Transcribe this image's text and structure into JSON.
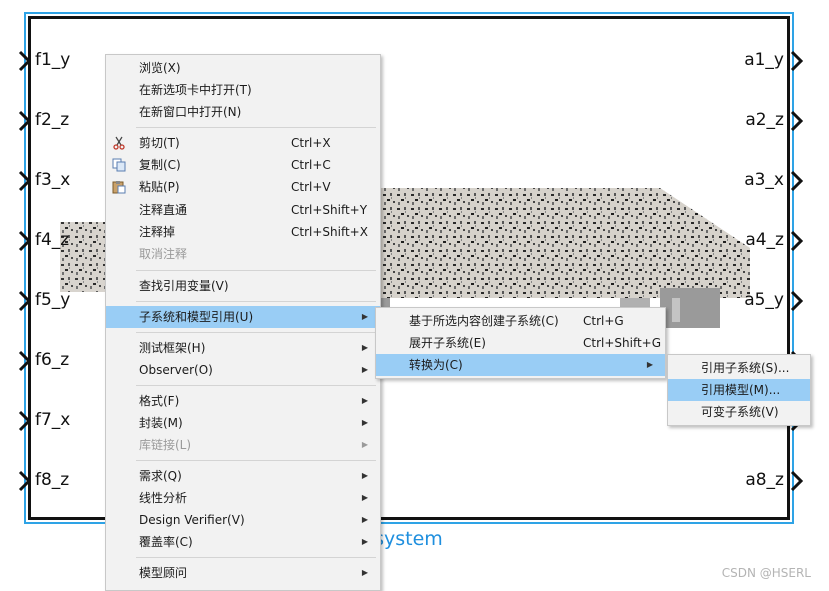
{
  "block": {
    "name_visible": "ubsystem",
    "inputs": [
      "f1_y",
      "f2_z",
      "f3_x",
      "f4_z",
      "f5_y",
      "f6_z",
      "f7_x",
      "f8_z"
    ],
    "outputs": [
      "a1_y",
      "a2_z",
      "a3_x",
      "a4_z",
      "a5_y",
      "a8_z"
    ]
  },
  "menu": {
    "items": [
      {
        "label": "浏览(X)"
      },
      {
        "label": "在新选项卡中打开(T)"
      },
      {
        "label": "在新窗口中打开(N)"
      },
      {
        "label": "剪切(T)",
        "shortcut": "Ctrl+X",
        "icon": "scissors-icon"
      },
      {
        "label": "复制(C)",
        "shortcut": "Ctrl+C",
        "icon": "copy-icon"
      },
      {
        "label": "粘贴(P)",
        "shortcut": "Ctrl+V",
        "icon": "paste-icon"
      },
      {
        "label": "注释直通",
        "shortcut": "Ctrl+Shift+Y"
      },
      {
        "label": "注释掉",
        "shortcut": "Ctrl+Shift+X"
      },
      {
        "label": "取消注释",
        "disabled": true
      },
      {
        "label": "查找引用变量(V)"
      },
      {
        "label": "子系统和模型引用(U)",
        "highlighted": true
      },
      {
        "label": "测试框架(H)"
      },
      {
        "label": "Observer(O)"
      },
      {
        "label": "格式(F)"
      },
      {
        "label": "封装(M)"
      },
      {
        "label": "库链接(L)",
        "disabled": true
      },
      {
        "label": "需求(Q)"
      },
      {
        "label": "线性分析"
      },
      {
        "label": "Design Verifier(V)"
      },
      {
        "label": "覆盖率(C)"
      },
      {
        "label": "模型顾问"
      }
    ]
  },
  "submenu": {
    "items": [
      {
        "label": "基于所选内容创建子系统(C)",
        "shortcut": "Ctrl+G"
      },
      {
        "label": "展开子系统(E)",
        "shortcut": "Ctrl+Shift+G"
      },
      {
        "label": "转换为(C)",
        "highlighted": true
      }
    ]
  },
  "submenu2": {
    "items": [
      {
        "label": "引用子系统(S)..."
      },
      {
        "label": "引用模型(M)...",
        "highlighted": true
      },
      {
        "label": "可变子系统(V)"
      }
    ]
  },
  "watermark": "CSDN @HSERL",
  "colors": {
    "highlight": "#99cdf5",
    "block_border": "#2ea3e6",
    "block_name": "#1f8fde"
  }
}
